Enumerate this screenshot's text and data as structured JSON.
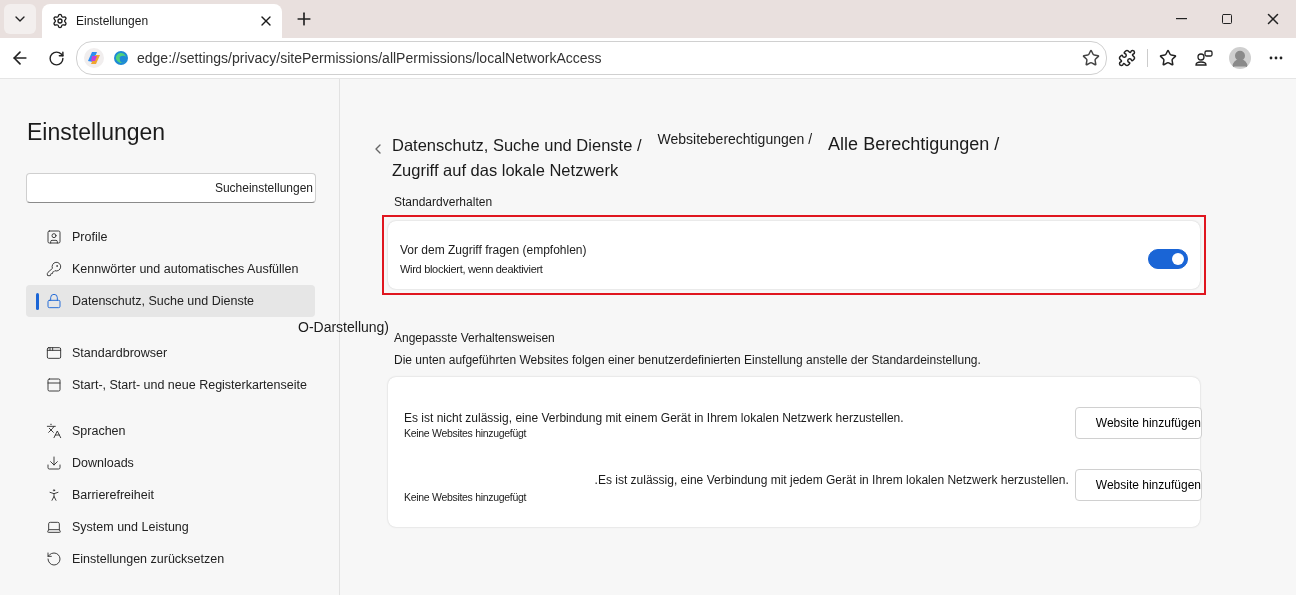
{
  "tab": {
    "title": "Einstellungen",
    "selected": true
  },
  "address_bar": {
    "url": "edge://settings/privacy/sitePermissions/allPermissions/localNetworkAccess"
  },
  "sidebar": {
    "title": "Einstellungen",
    "search": {
      "placeholder": "Sucheinstellungen"
    },
    "groups": [
      [
        {
          "label": "Profile",
          "selected": false
        },
        {
          "label": "Kennwörter und automatisches Ausfüllen",
          "selected": false
        },
        {
          "label": "Datenschutz, Suche und Dienste",
          "selected": true
        }
      ],
      [
        {
          "label": "Standardbrowser",
          "selected": false
        },
        {
          "label": "Start-, Start- und neue Registerkartenseite",
          "selected": false
        }
      ],
      [
        {
          "label": "Sprachen",
          "selected": false
        },
        {
          "label": "Downloads",
          "selected": false
        },
        {
          "label": "Barrierefreiheit",
          "selected": false
        },
        {
          "label": "System und Leistung",
          "selected": false
        },
        {
          "label": "Einstellungen zurücksetzen",
          "selected": false
        }
      ]
    ],
    "stray_text": "O-Darstellung)"
  },
  "breadcrumb": [
    {
      "label": "Datenschutz, Suche und Dienste /",
      "kind": "medium"
    },
    {
      "label": "Websiteberechtigungen /",
      "kind": "small"
    },
    {
      "label": "Alle Berechtigungen /",
      "kind": "large"
    },
    {
      "label": "Zugriff auf das lokale Netzwerk",
      "kind": "medium"
    }
  ],
  "default_behavior": {
    "heading": "Standardverhalten",
    "title": "Vor dem Zugriff fragen (empfohlen)",
    "subtitle": "Wird blockiert, wenn deaktiviert",
    "on": true,
    "highlighted": true
  },
  "custom_behaviors": {
    "heading": "Angepasste Verhaltensweisen",
    "description": "Die unten aufgeführten Websites folgen einer benutzerdefinierten Einstellung anstelle der Standardeinstellung.",
    "rows": [
      {
        "title": "Es ist nicht zulässig, eine Verbindung mit einem Gerät in Ihrem lokalen Netzwerk herzustellen.",
        "empty": "Keine Websites hinzugefügt",
        "button": "Website hinzufügen",
        "kind": "left"
      },
      {
        "title": ".Es ist zulässig, eine Verbindung mit jedem Gerät in Ihrem lokalen Netzwerk herzustellen.",
        "empty": "Keine Websites hinzugefügt",
        "button": "Website hinzufügen",
        "kind": "right"
      }
    ]
  }
}
